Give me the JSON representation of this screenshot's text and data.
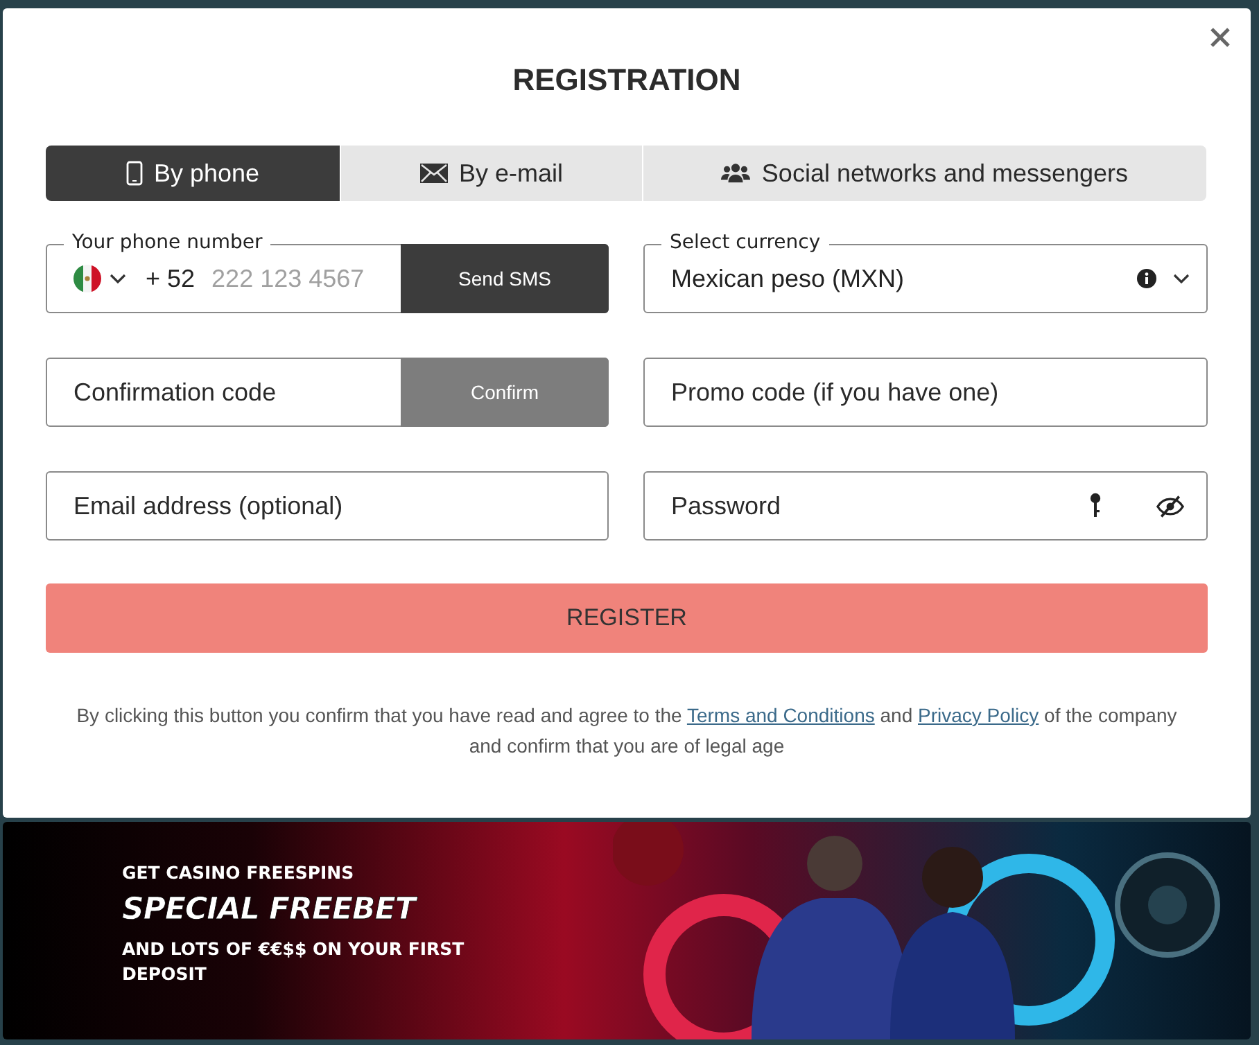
{
  "dialog": {
    "title": "REGISTRATION"
  },
  "tabs": [
    {
      "label": "By phone",
      "kind": "phone",
      "selected": true
    },
    {
      "label": "By e-mail",
      "kind": "email",
      "selected": false
    },
    {
      "label": "Social networks and messengers",
      "kind": "social",
      "selected": false
    }
  ],
  "phone": {
    "label": "Your phone number",
    "code": "+ 52",
    "placeholder": "222 123 4567",
    "button": "Send SMS"
  },
  "currency": {
    "label": "Select currency",
    "value": "Mexican peso (MXN)"
  },
  "confirmation": {
    "placeholder": "Confirmation code",
    "button": "Confirm",
    "disabled": true
  },
  "promo": {
    "placeholder": "Promo code (if you have one)"
  },
  "email": {
    "placeholder": "Email address (optional)"
  },
  "password": {
    "placeholder": "Password"
  },
  "register": {
    "label": "REGISTER"
  },
  "disclaimer": {
    "before": "By clicking this button you confirm that you have read and agree to the",
    "link_terms": "Terms and Conditions",
    "middle": "and",
    "link_privacy": "Privacy Policy",
    "after": "of the company and confirm that you are of legal age"
  },
  "banner": {
    "tagline": "GET CASINO FREESPINS",
    "headline": "SPECIAL FREEBET",
    "offer": "AND LOTS OF €€$$ ON YOUR FIRST DEPOSIT"
  }
}
